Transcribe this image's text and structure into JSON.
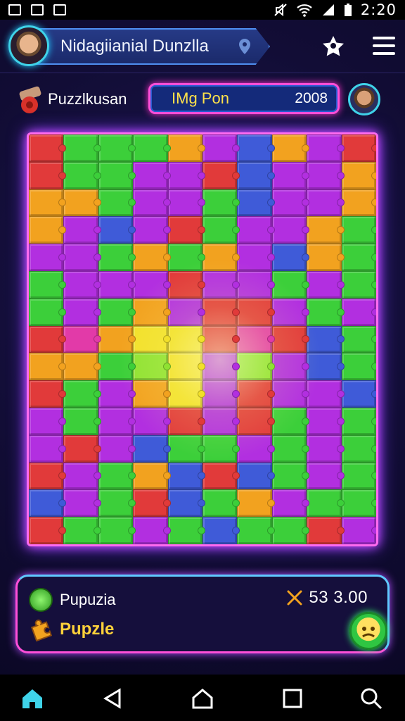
{
  "status_bar": {
    "time": "2:20"
  },
  "header": {
    "player_name": "Nidagiianial Dunzlla",
    "icons": [
      "pin-icon",
      "star-icon",
      "hamburger-menu-icon"
    ]
  },
  "subheader": {
    "brand": "Puzzlkusan",
    "pill_label": "IMg Pon",
    "pill_value": "2008"
  },
  "board": {
    "rows": 15,
    "columns": 10,
    "palette": {
      "G": "#3ccf3a",
      "P": "#b22fe0",
      "R": "#e13a3a",
      "O": "#f2a21f",
      "B": "#3f5bd8",
      "Y": "#f2e02a",
      "M": "#e23aa8",
      "L": "#8fe232"
    },
    "tiles": [
      "RGGGOPBOPR",
      "RGGPPRBPPO",
      "OOGPPGBPPO",
      "OPBPRGPPOG",
      "PPGOGOPBOG",
      "GPPPRPPGPG",
      "GPGOPRRPGP",
      "RMOYYRMRBG",
      "OOGLYPLPBG",
      "RGPOYPRPPB",
      "PGPPRPRGPG",
      "PRPBGGPGPG",
      "RPGOBRBGPG",
      "BPGRBGOPGG",
      "RGGPGBGGRP"
    ]
  },
  "info_panel": {
    "label1": "Pupuzia",
    "label2": "Pupzle",
    "score": "53 3.00"
  },
  "nav_bar": {
    "icons": [
      "home-icon",
      "back-icon",
      "home-circle-icon",
      "recents-icon",
      "search-icon"
    ]
  },
  "colors": {
    "accent_pink": "#ff4fd8",
    "accent_cyan": "#3fd3e9",
    "score_gold": "#ffe24a",
    "background": "#0e0a2a"
  }
}
